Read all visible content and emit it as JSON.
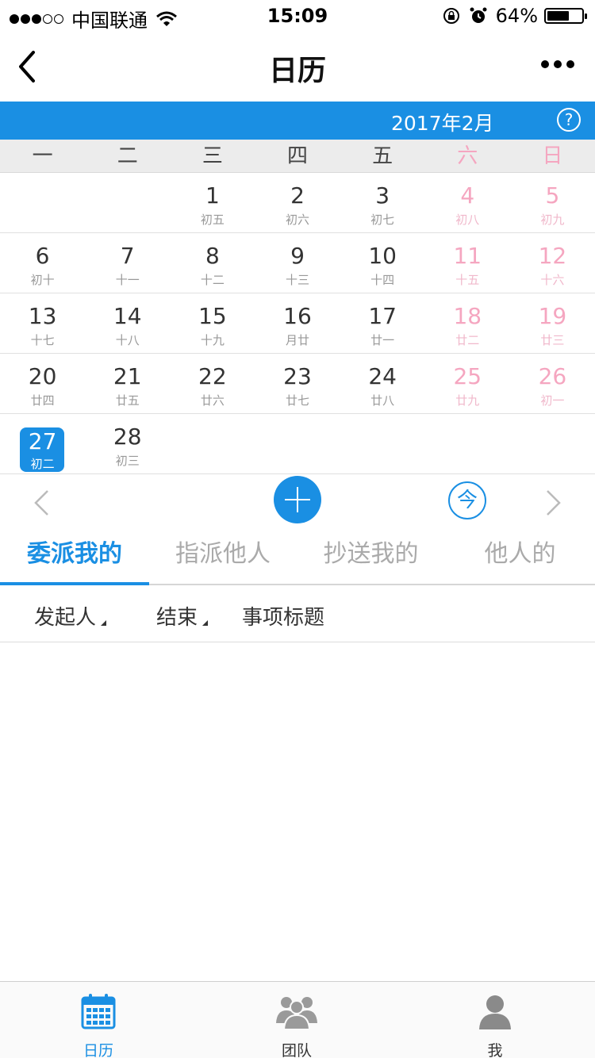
{
  "status_bar": {
    "carrier": "中国联通",
    "time": "15:09",
    "battery_pct": "64%",
    "battery_level": 0.64
  },
  "nav": {
    "title": "日历",
    "back_icon": "chevron-left-icon",
    "more_icon": "more-icon"
  },
  "calendar": {
    "month_label": "2017年2月",
    "help_label": "?",
    "weekdays": [
      "一",
      "二",
      "三",
      "四",
      "五",
      "六",
      "日"
    ],
    "weeks": [
      [
        {
          "d": "",
          "l": ""
        },
        {
          "d": "",
          "l": ""
        },
        {
          "d": "1",
          "l": "初五"
        },
        {
          "d": "2",
          "l": "初六"
        },
        {
          "d": "3",
          "l": "初七"
        },
        {
          "d": "4",
          "l": "初八"
        },
        {
          "d": "5",
          "l": "初九"
        }
      ],
      [
        {
          "d": "6",
          "l": "初十"
        },
        {
          "d": "7",
          "l": "十一"
        },
        {
          "d": "8",
          "l": "十二"
        },
        {
          "d": "9",
          "l": "十三"
        },
        {
          "d": "10",
          "l": "十四"
        },
        {
          "d": "11",
          "l": "十五"
        },
        {
          "d": "12",
          "l": "十六"
        }
      ],
      [
        {
          "d": "13",
          "l": "十七"
        },
        {
          "d": "14",
          "l": "十八"
        },
        {
          "d": "15",
          "l": "十九"
        },
        {
          "d": "16",
          "l": "月廿"
        },
        {
          "d": "17",
          "l": "廿一"
        },
        {
          "d": "18",
          "l": "廿二"
        },
        {
          "d": "19",
          "l": "廿三"
        }
      ],
      [
        {
          "d": "20",
          "l": "廿四"
        },
        {
          "d": "21",
          "l": "廿五"
        },
        {
          "d": "22",
          "l": "廿六"
        },
        {
          "d": "23",
          "l": "廿七"
        },
        {
          "d": "24",
          "l": "廿八"
        },
        {
          "d": "25",
          "l": "廿九"
        },
        {
          "d": "26",
          "l": "初一"
        }
      ],
      [
        {
          "d": "27",
          "l": "初二",
          "selected": true
        },
        {
          "d": "28",
          "l": "初三"
        },
        {
          "d": "",
          "l": ""
        },
        {
          "d": "",
          "l": ""
        },
        {
          "d": "",
          "l": ""
        },
        {
          "d": "",
          "l": ""
        },
        {
          "d": "",
          "l": ""
        }
      ]
    ],
    "today_label": "今"
  },
  "tabs": [
    {
      "label": "委派我的",
      "active": true
    },
    {
      "label": "指派他人",
      "active": false
    },
    {
      "label": "抄送我的",
      "active": false
    },
    {
      "label": "他人的",
      "active": false
    }
  ],
  "columns": {
    "initiator": "发起人",
    "end": "结束",
    "subject": "事项标题"
  },
  "tabbar": [
    {
      "label": "日历",
      "icon": "calendar-icon",
      "active": true
    },
    {
      "label": "团队",
      "icon": "team-icon",
      "active": false
    },
    {
      "label": "我",
      "icon": "user-icon",
      "active": false
    }
  ],
  "colors": {
    "accent": "#1a8fe3",
    "weekend": "#f5a6c0"
  }
}
